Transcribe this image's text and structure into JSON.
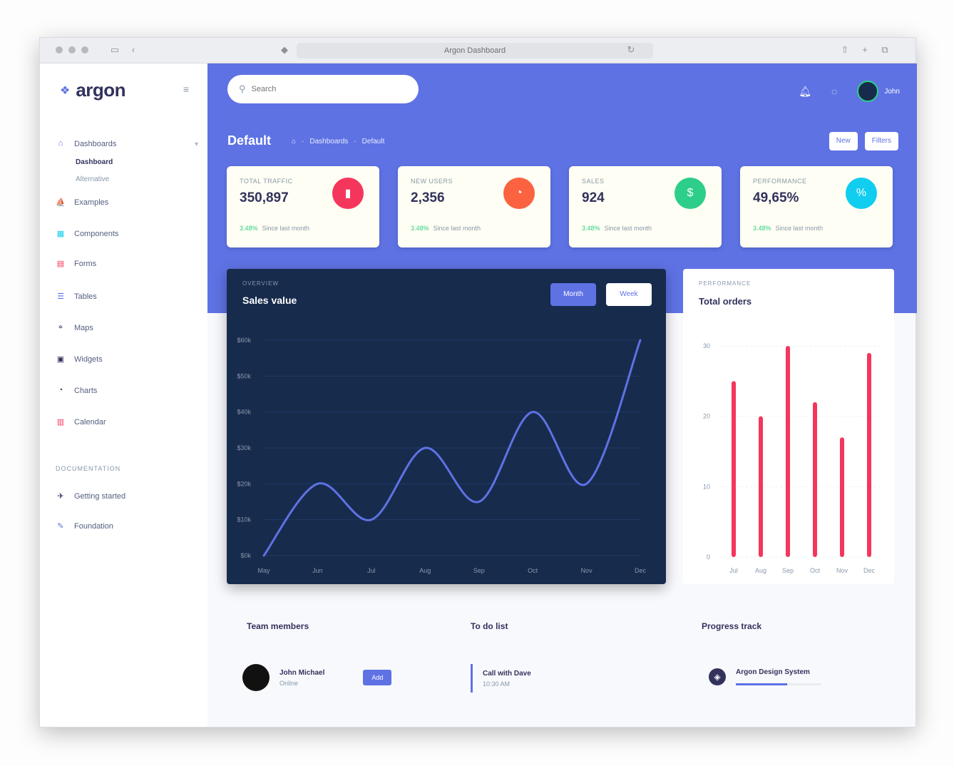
{
  "browser": {
    "url": "Argon Dashboard"
  },
  "sidebar": {
    "brand": "argon",
    "items": [
      {
        "label": "Dashboards",
        "icon": "home-icon",
        "expanded": true
      },
      {
        "label": "Dashboard",
        "sub": true,
        "active": true
      },
      {
        "label": "Alternative",
        "sub": true
      },
      {
        "label": "Examples",
        "icon": "ship-icon"
      },
      {
        "label": "Components",
        "icon": "ui-icon"
      },
      {
        "label": "Forms",
        "icon": "single-copy-icon"
      },
      {
        "label": "Tables",
        "icon": "align-icon"
      },
      {
        "label": "Maps",
        "icon": "map-pin-icon"
      },
      {
        "label": "Widgets",
        "icon": "archive-icon"
      },
      {
        "label": "Charts",
        "icon": "chart-pie-icon"
      },
      {
        "label": "Calendar",
        "icon": "calendar-icon"
      }
    ],
    "heading": "Documentation",
    "docs": [
      {
        "label": "Getting started",
        "icon": "spaceship-icon"
      },
      {
        "label": "Foundation",
        "icon": "palette-icon"
      }
    ]
  },
  "header": {
    "search_placeholder": "Search",
    "user_name": "John",
    "page_title": "Default",
    "breadcrumb": [
      "Dashboards",
      "Default"
    ],
    "buttons": [
      "New",
      "Filters"
    ]
  },
  "stats": [
    {
      "label": "Total traffic",
      "value": "350,897",
      "color": "#f5365c",
      "icon": "chart-bar-icon",
      "change": "3.48%",
      "period": "Since last month"
    },
    {
      "label": "New users",
      "value": "2,356",
      "color": "#fb6340",
      "icon": "chart-pie-icon",
      "change": "3.48%",
      "period": "Since last month"
    },
    {
      "label": "Sales",
      "value": "924",
      "color": "#2dce89",
      "icon": "money-icon",
      "change": "3.48%",
      "period": "Since last month"
    },
    {
      "label": "Performance",
      "value": "49,65%",
      "color": "#11cdef",
      "icon": "percent-icon",
      "change": "3.48%",
      "period": "Since last month"
    }
  ],
  "sales_card": {
    "overline": "Overview",
    "title": "Sales value",
    "tabs": [
      "Month",
      "Week"
    ]
  },
  "orders_card": {
    "overline": "Performance",
    "title": "Total orders"
  },
  "chart_data": [
    {
      "type": "line",
      "title": "Sales value",
      "x": [
        "May",
        "Jun",
        "Jul",
        "Aug",
        "Sep",
        "Oct",
        "Nov",
        "Dec"
      ],
      "series": [
        {
          "values": [
            0,
            20,
            10,
            30,
            15,
            40,
            20,
            60
          ]
        }
      ],
      "ylim": [
        0,
        60
      ],
      "yticks": [
        "$0k",
        "$10k",
        "$20k",
        "$30k",
        "$40k",
        "$50k",
        "$60k"
      ],
      "line_color": "#5e72e4",
      "smooth": true
    },
    {
      "type": "bar",
      "title": "Total orders",
      "categories": [
        "Jul",
        "Aug",
        "Sep",
        "Oct",
        "Nov",
        "Dec"
      ],
      "values": [
        25,
        20,
        30,
        22,
        17,
        29
      ],
      "ylim": [
        0,
        30
      ],
      "yticks": [
        "0",
        "10",
        "20",
        "30"
      ],
      "bar_color": "#f5365c"
    }
  ],
  "bottom": {
    "team_title": "Team members",
    "todo_title": "To do list",
    "progress_title": "Progress track",
    "team_member": {
      "name": "John Michael",
      "status": "Online",
      "button": "Add"
    },
    "todo_item": {
      "title": "Call with Dave",
      "time": "10:30 AM"
    },
    "project": {
      "name": "Argon Design System",
      "progress": 0.6
    }
  }
}
